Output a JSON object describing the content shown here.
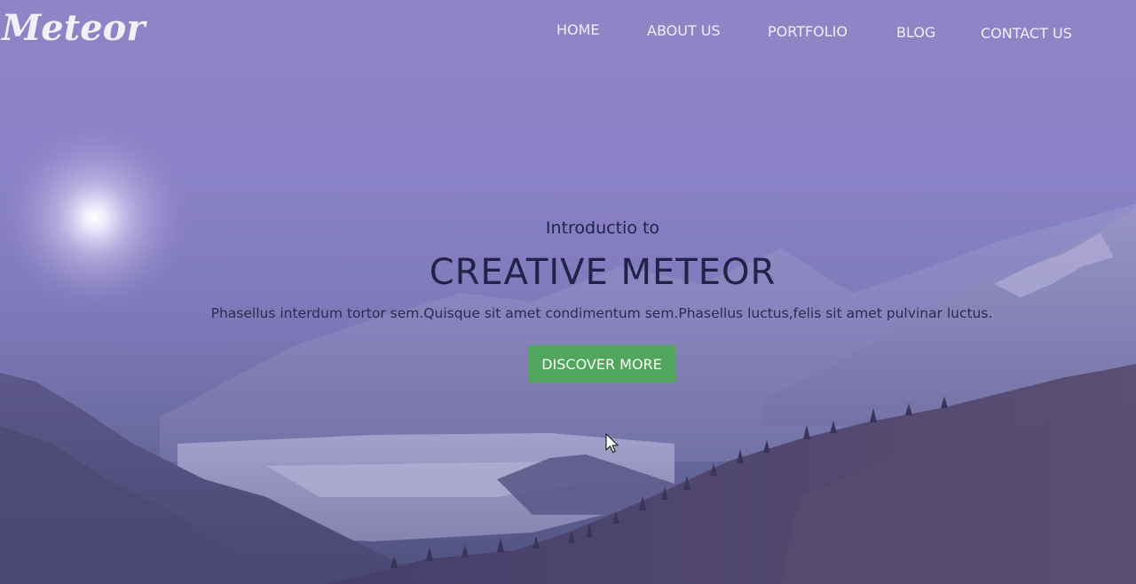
{
  "brand": {
    "logo_text": "Meteor"
  },
  "nav": {
    "items": [
      {
        "label": "HOME"
      },
      {
        "label": "ABOUT US"
      },
      {
        "label": "PORTFOLIO"
      },
      {
        "label": "BLOG"
      },
      {
        "label": "CONTACT US"
      }
    ]
  },
  "hero": {
    "intro": "Introductio to",
    "title": "CREATIVE METEOR",
    "description": "Phasellus interdum tortor sem.Quisque sit amet condimentum sem.Phasellus luctus,felis sit amet pulvinar luctus.",
    "cta_label": "DISCOVER MORE"
  },
  "colors": {
    "overlay": "#8b82c7",
    "cta": "#52a55c",
    "title_text": "#25214a",
    "nav_text": "#f1eefc"
  },
  "icons": {
    "cursor": "mouse-pointer-icon",
    "moon": "moon-glow"
  }
}
